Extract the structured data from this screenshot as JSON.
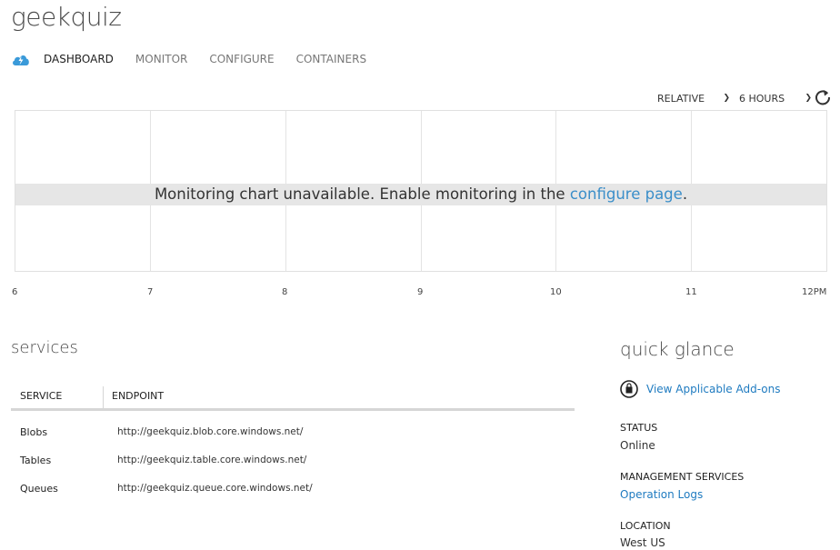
{
  "page": {
    "title": "geekquiz"
  },
  "nav": {
    "icon": "cloud-storage-icon",
    "tabs": [
      {
        "label": "DASHBOARD",
        "active": true
      },
      {
        "label": "MONITOR",
        "active": false
      },
      {
        "label": "CONFIGURE",
        "active": false
      },
      {
        "label": "CONTAINERS",
        "active": false
      }
    ]
  },
  "chart_controls": {
    "range_type": "RELATIVE",
    "range_value": "6 HOURS",
    "refresh_icon": "refresh-icon"
  },
  "monitor_chart": {
    "message": "Monitoring chart unavailable. Enable monitoring in the ",
    "link": "configure page",
    "suffix": ".",
    "x_ticks": [
      "6",
      "7",
      "8",
      "9",
      "10",
      "11",
      "12PM"
    ]
  },
  "services": {
    "heading": "services",
    "columns": [
      "SERVICE",
      "ENDPOINT"
    ],
    "rows": [
      {
        "service": "Blobs",
        "endpoint": "http://geekquiz.blob.core.windows.net/"
      },
      {
        "service": "Tables",
        "endpoint": "http://geekquiz.table.core.windows.net/"
      },
      {
        "service": "Queues",
        "endpoint": "http://geekquiz.queue.core.windows.net/"
      }
    ]
  },
  "quick_glance": {
    "heading": "quick glance",
    "addons_link": "View Applicable Add-ons",
    "addons_icon": "shopping-bag-icon",
    "status_label": "STATUS",
    "status_value": "Online",
    "mgmt_label": "MANAGEMENT SERVICES",
    "mgmt_link": "Operation Logs",
    "location_label": "LOCATION",
    "location_value": "West US"
  },
  "colors": {
    "link": "#1f7bc0",
    "nav_icon": "#3a9ad9",
    "banner_bg": "#e6e6e6"
  }
}
